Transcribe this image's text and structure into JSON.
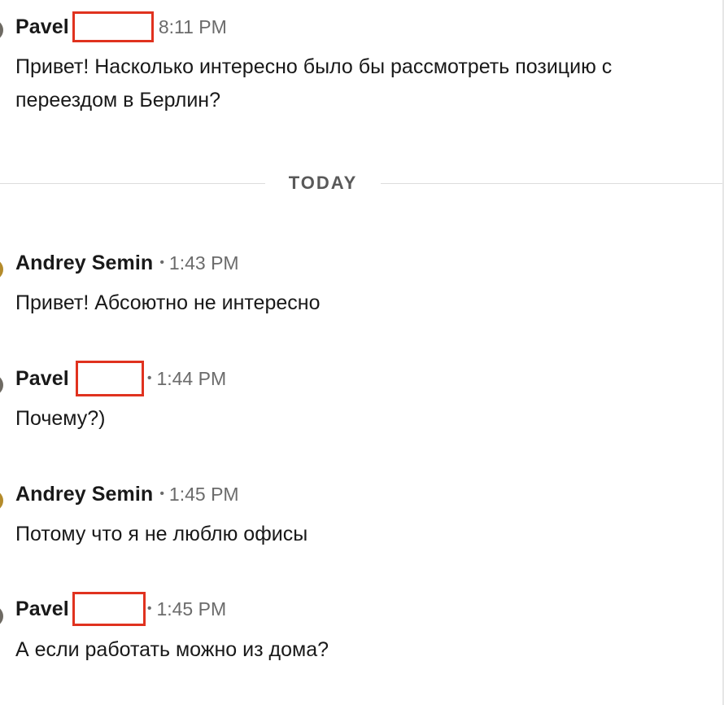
{
  "messages": [
    {
      "sender": "Pavel",
      "separator": "",
      "time": "8:11 PM",
      "text": "Привет! Насколько интересно было бы рассмотреть позицию с переездом в Берлин?"
    },
    {
      "sender": "Andrey Semin",
      "separator": "•",
      "time": "1:43 PM",
      "text": "Привет! Абсоютно не интересно"
    },
    {
      "sender": "Pavel",
      "separator": "•",
      "time": "1:44 PM",
      "text": "Почему?)"
    },
    {
      "sender": "Andrey Semin",
      "separator": "•",
      "time": "1:45 PM",
      "text": "Потому что я не люблю офисы"
    },
    {
      "sender": "Pavel",
      "separator": "•",
      "time": "1:45 PM",
      "text": "А если работать можно из дома?"
    }
  ],
  "day_divider": {
    "label": "TODAY"
  },
  "colors": {
    "redaction_box": "#e0321f",
    "divider_line": "#dcdcdc",
    "timestamp": "#6b6b6b"
  }
}
